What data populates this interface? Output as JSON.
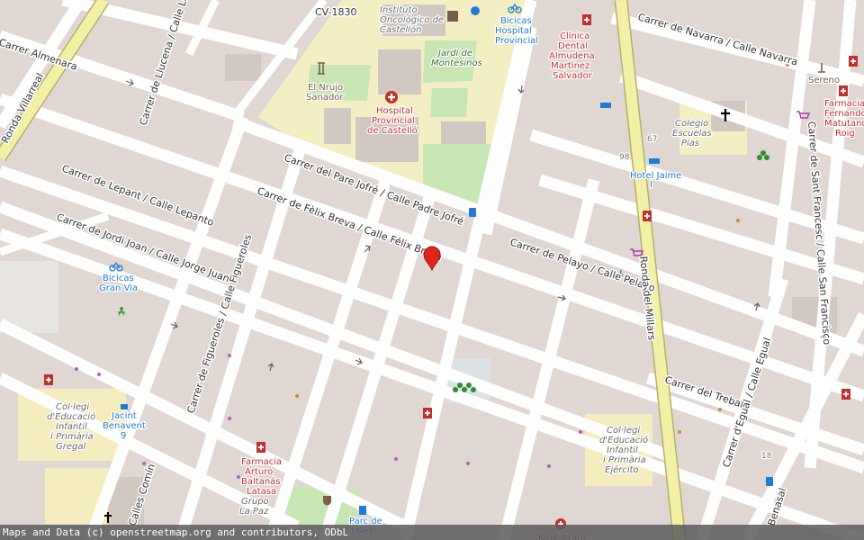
{
  "streets": {
    "almenara": "Carrer Almenara",
    "villarreal": "Ronda Villarreal",
    "lucena": "Carrer de Llucena / Calle Lucena",
    "cv1830": "CV-1830",
    "navarra": "Carrer de Navarra / Calle Navarra",
    "padre_jofre": "Carrer del Pare Jofré / Calle Padre Jofré",
    "lepant": "Carrer de Lepant / Calle Lepanto",
    "felix_breva": "Carrer de Fèlix Breva / Calle Félix Breva",
    "jorge_juan": "Carrer de Jordi Joan / Calle Jorge Juan",
    "figueroles": "Carrer de Figueroles / Calle Figueroles",
    "pelayo": "Carrer de Pelayo / Calle Pelayo",
    "millars": "Ronda del Millars",
    "sant_francesc": "Carrer de Sant Francesc / Calle San Francisco",
    "treball": "Carrer del Treball",
    "equal": "Carrer d'Egual / Calle Egual",
    "comin": "Calles Comín",
    "benasal": "Benasal"
  },
  "pois": {
    "instituto": "Instituto Oncológico de Castellón",
    "bicicas_hospital": "Bicicas Hospital Provincial",
    "clinica": "Clínica Dental Almudena Martínez Salvador",
    "jardi": "Jardí de Montesinos",
    "nrujo": "El Nrujo Sanador",
    "hospital": "Hospital Provincial de Castelló",
    "sereno": "Sereno",
    "farmacia_fernando": "Farmacia Fernando Matutano Roig",
    "colegio_pias": "Colegio Escuelas Pías",
    "hotel_jaime": "Hotel Jaime I",
    "bicicas_granvia": "Bicicas Gran Via",
    "jacint": "Jacint Benavent 9",
    "col_gregal": "Col·legi d'Educació Infantil i Primària Gregal",
    "col_ejercito": "Col·legi d'Educació Infantil i Primària Ejército",
    "farmacia_arturo": "Farmacia Arturo Baltanás Latasa",
    "grupo_lapaz": "Grupo La Paz",
    "parc": "Parc de l'Oest",
    "kine": "Kine Avant"
  },
  "house_numbers": {
    "n67": "67",
    "n98": "98",
    "n18": "18"
  },
  "marker": {
    "icon": "map-pin-icon",
    "color": "#e3241b",
    "lat_lon_shown": false
  },
  "attribution": {
    "prefix": "Maps and Data (c) ",
    "link": "openstreetmap.org",
    "suffix": " and contributors, ODbL"
  },
  "colors": {
    "land": "#e0d7d3",
    "building": "#d2c8c2",
    "road": "#ffffff",
    "primary_road": "#f2f0a4",
    "hospital_area": "#f3efc2",
    "park": "#c8e6b4",
    "school": "#f5edbe",
    "marker": "#e3241b",
    "poi_red": "#c0302f",
    "poi_blue": "#1f7bd6"
  }
}
